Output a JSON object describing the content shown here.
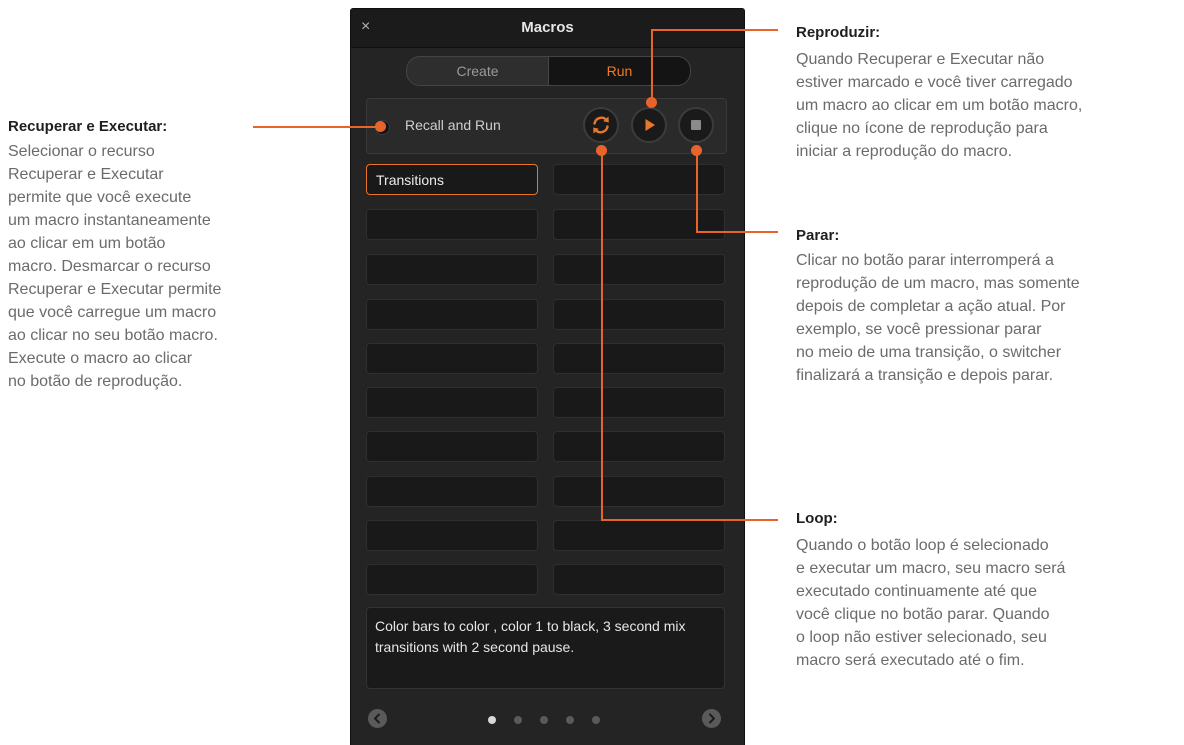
{
  "window": {
    "title": "Macros",
    "close_glyph": "×"
  },
  "tabs": [
    {
      "label": "Create",
      "selected": false
    },
    {
      "label": "Run",
      "selected": true
    }
  ],
  "recall_and_run": {
    "label": "Recall and Run",
    "checked": false
  },
  "controls": {
    "loop_icon": "loop-icon",
    "play_icon": "play-icon",
    "stop_icon": "stop-icon"
  },
  "macro_buttons": [
    "Transitions",
    "",
    "",
    "",
    "",
    "",
    "",
    "",
    "",
    "",
    "",
    "",
    "",
    "",
    "",
    "",
    "",
    "",
    "",
    ""
  ],
  "selected_macro_index": 0,
  "macro_description": "Color bars to color , color 1 to black, 3 second mix transitions with 2 second pause.",
  "pagination": {
    "pages": 5,
    "current": 1,
    "prev_icon": "chevron-left-icon",
    "next_icon": "chevron-right-icon"
  },
  "annotations": {
    "recall": {
      "title": "Recuperar e Executar:",
      "text": "Selecionar o recurso\nRecuperar e Executar\npermite que você execute\num macro instantaneamente\nao clicar em um botão\nmacro. Desmarcar o recurso\nRecuperar e Executar permite\nque você carregue um macro\nao clicar no seu botão macro.\nExecute o macro ao clicar\nno botão de reprodução."
    },
    "play": {
      "title": "Reproduzir:",
      "text": "Quando Recuperar e Executar não\nestiver marcado e você tiver carregado\num macro ao clicar em um botão macro,\nclique no ícone de reprodução para\niniciar a reprodução do macro."
    },
    "stop": {
      "title": "Parar:",
      "text": "Clicar no botão parar interromperá a\nreprodução de um macro, mas somente\ndepois de completar a ação atual. Por\nexemplo, se você pressionar parar\nno meio de uma transição, o switcher\nfinalizará a transição e depois parar."
    },
    "loop": {
      "title": "Loop:",
      "text": "Quando o botão loop é selecionado\ne executar um macro, seu macro será\nexecutado continuamente até que\nvocê clique no botão parar. Quando\no loop não estiver selecionado, seu\nmacro será executado até o fim."
    }
  },
  "colors": {
    "accent": "#e8642a",
    "run_tab_text": "#f07a26",
    "panel_bg": "#242424"
  }
}
